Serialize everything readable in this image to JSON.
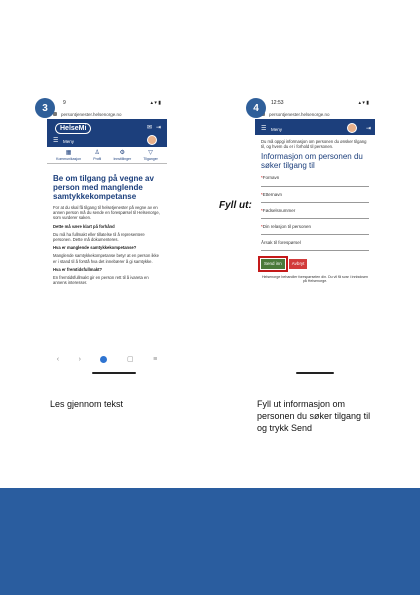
{
  "steps": [
    {
      "number": "3",
      "status_time": "9",
      "url": "persontjenester.helsenorge.no",
      "app_logo": "HelseMi",
      "menu_label": "Meny",
      "tabs": [
        "Kommunikasjon",
        "Profil",
        "Innstillinger",
        "Tilganger"
      ],
      "title": "Be om tilgang på vegne av person med manglende samtykkekompetanse",
      "paragraphs": [
        "For at du skal få tilgang til helsetjenester på vegne av en annen person må du sende en forespørsel til Helsenorge, som vurderer saken.",
        "Dette må være klart på forhånd",
        "Du må ha fullmakt eller tillatelse til å representere personen. Dette må dokumenteres.",
        "Hva er manglende samtykkekompetanse?",
        "Manglende samtykkekompetanse betyr at en person ikke er i stand til å forstå hva det innebærer å gi samtykke.",
        "Hva er fremtidsfullmakt?",
        "En fremtidsfullmakt gir en person rett til å ivareta en annens interesser."
      ],
      "caption": "Les gjennom tekst"
    },
    {
      "number": "4",
      "status_time": "12:53",
      "url": "persontjenester.helsenorge.no",
      "menu_label": "Meny",
      "intro": "Du må oppgi informasjon om personen du ønsker tilgang til, og hvem du er i forhold til personen.",
      "form_title": "Informasjon om personen du søker tilgang til",
      "fields": [
        {
          "label": "Fornavn",
          "required": true
        },
        {
          "label": "Etternavn",
          "required": true
        },
        {
          "label": "Fødselsnummer",
          "required": true
        },
        {
          "label": "Din relasjon til personen",
          "required": true
        },
        {
          "label": "Årsak til forespørsel",
          "required": false
        }
      ],
      "send_label": "Send inn",
      "cancel_label": "Avbryt",
      "footnote": "Helsenorge behandler forespørselen din. Du vil få svar i innboksen på Helsenorge.",
      "caption": "Fyll ut informasjon om personen du søker tilgang til og trykk Send"
    }
  ],
  "fill_label": "Fyll ut:",
  "colors": {
    "badge": "#2f5f9a",
    "header": "#1c3f7c",
    "footer_band": "#2a5d9f",
    "send": "#4a7a3a",
    "cancel": "#d23b3b",
    "highlight": "#c41a1a"
  }
}
